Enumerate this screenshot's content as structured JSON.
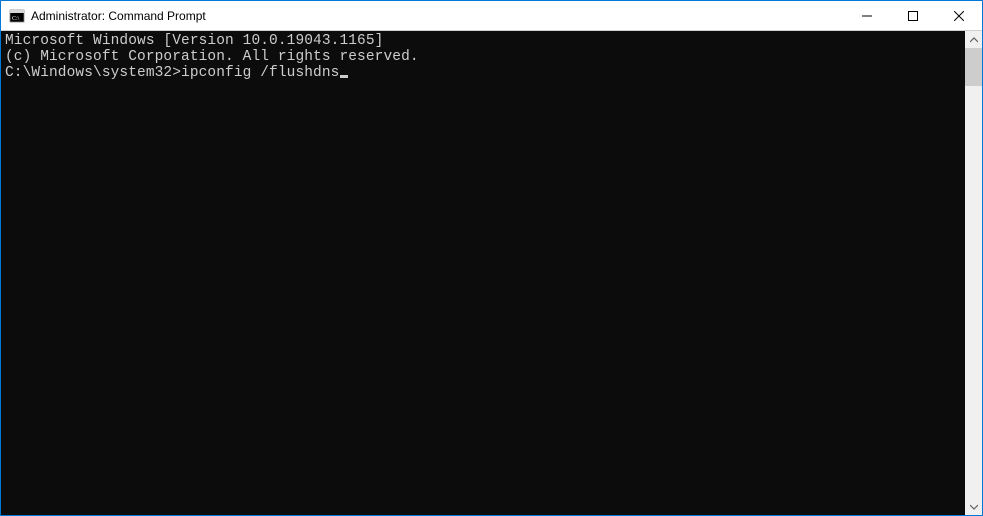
{
  "window": {
    "title": "Administrator: Command Prompt"
  },
  "terminal": {
    "line1": "Microsoft Windows [Version 10.0.19043.1165]",
    "line2": "(c) Microsoft Corporation. All rights reserved.",
    "blank": "",
    "prompt": "C:\\Windows\\system32>",
    "command": "ipconfig /flushdns"
  }
}
